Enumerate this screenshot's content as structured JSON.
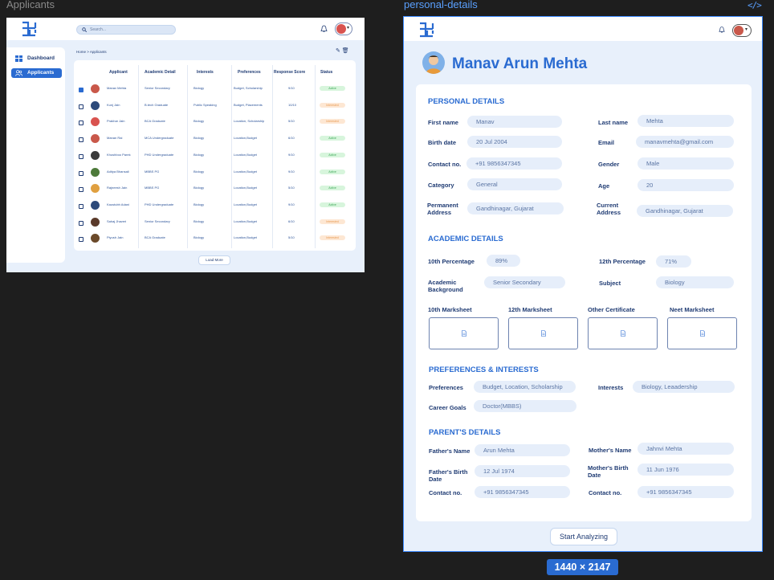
{
  "canvas": {
    "left_frame_label": "Applicants",
    "right_frame_label": "personal-details",
    "code_icon": "</>",
    "size_badge": "1440 × 2147"
  },
  "applicants": {
    "search_placeholder": "Search...",
    "sidebar": [
      {
        "label": "Dashboard",
        "icon": "grid-icon"
      },
      {
        "label": "Applicants",
        "icon": "users-icon",
        "active": true
      }
    ],
    "breadcrumb": "Home > Applicants",
    "tools": "✎ 🗑",
    "columns": [
      "Applicant",
      "Academic Detail",
      "Interests",
      "Preferences",
      "Response Score",
      "Status"
    ],
    "rows": [
      {
        "name": "Manav Mehta",
        "academic": "Senior Secondary",
        "interests": "Biology",
        "prefs": "Budget, Scholarship",
        "score": "9/10",
        "status": "Active",
        "checked": true,
        "av": "#c9584a"
      },
      {
        "name": "Kunj Jain",
        "academic": "B.tech Graduate",
        "interests": "Public Speaking",
        "prefs": "Budget, Placements",
        "score": "10/10",
        "status": "Interested",
        "checked": false,
        "av": "#2d4a7a"
      },
      {
        "name": "Prakhar Jain",
        "academic": "BCA Graduate",
        "interests": "Biology",
        "prefs": "Location, Scholarship",
        "score": "5/10",
        "status": "Interested",
        "checked": false,
        "av": "#d9534f"
      },
      {
        "name": "Manan Rai",
        "academic": "MCA Undergraduate",
        "interests": "Biology",
        "prefs": "Location,Budget",
        "score": "6/10",
        "status": "Active",
        "checked": false,
        "av": "#c9584a"
      },
      {
        "name": "Khushboo Parek",
        "academic": "PHD Undergraduate",
        "interests": "Biology",
        "prefs": "Location,Budget",
        "score": "9/10",
        "status": "Active",
        "checked": false,
        "av": "#3a3a3a"
      },
      {
        "name": "Aditya Bhansali",
        "academic": "MBBS PG",
        "interests": "Biology",
        "prefs": "Location,Budget",
        "score": "9/10",
        "status": "Active",
        "checked": false,
        "av": "#4d7a3a"
      },
      {
        "name": "Rajneesh Jain",
        "academic": "MBBS PG",
        "interests": "Biology",
        "prefs": "Location,Budget",
        "score": "5/10",
        "status": "Active",
        "checked": false,
        "av": "#e0a040"
      },
      {
        "name": "Kaustubh Adani",
        "academic": "PHD Undergraduate",
        "interests": "Biology",
        "prefs": "Location,Budget",
        "score": "9/10",
        "status": "Active",
        "checked": false,
        "av": "#2d4a7a"
      },
      {
        "name": "Sahaj Jhaveri",
        "academic": "Senior Secondary",
        "interests": "Biology",
        "prefs": "Location,Budget",
        "score": "6/10",
        "status": "Interested",
        "checked": false,
        "av": "#5a3a2a"
      },
      {
        "name": "Piyush Jain",
        "academic": "BCA Graduate",
        "interests": "Biology",
        "prefs": "Location,Budget",
        "score": "5/10",
        "status": "Interested",
        "checked": false,
        "av": "#6b4a2a"
      }
    ],
    "load_more": "Load More"
  },
  "details": {
    "name": "Manav Arun Mehta",
    "sections": {
      "personal": "PERSONAL DETAILS",
      "academic": "ACADEMIC DETAILS",
      "prefs": "PREFERENCES & INTERESTS",
      "parents": "PARENT'S  DETAILS"
    },
    "personal": {
      "first_name_label": "First name",
      "first_name": "Manav",
      "last_name_label": "Last name",
      "last_name": "Mehta",
      "birth_label": "Birth date",
      "birth": "20 Jul 2004",
      "email_label": "Email",
      "email": "manavmehta@gmail.com",
      "contact_label": "Contact no.",
      "contact": "+91 9856347345",
      "gender_label": "Gender",
      "gender": "Male",
      "category_label": "Category",
      "category": "General",
      "age_label": "Age",
      "age": "20",
      "perm_label_1": "Permanent",
      "perm_label_2": "Address",
      "perm": "Gandhinagar, Gujarat",
      "curr_label_1": "Current",
      "curr_label_2": "Address",
      "curr": "Gandhinagar, Gujarat"
    },
    "academic": {
      "tenth_label": "10th Percentage",
      "tenth": "89%",
      "twelfth_label": "12th Percentage",
      "twelfth": "71%",
      "bg_label_1": "Academic",
      "bg_label_2": "Background",
      "bg": "Senior Secondary",
      "subject_label": "Subject",
      "subject": "Biology",
      "uploads": [
        "10th  Marksheet",
        "12th Marksheet",
        "Other Certificate",
        "Neet  Marksheet"
      ]
    },
    "prefs": {
      "pref_label": "Preferences",
      "pref": "Budget, Location, Scholarship",
      "interests_label": "Interests",
      "interests": "Biology, Leaadership",
      "goals_label": "Career Goals",
      "goals": "Doctor(MBBS)"
    },
    "parents": {
      "father_label": "Father's Name",
      "father": "Arun Mehta",
      "mother_label": "Mother's Name",
      "mother": "Jahnvi Mehta",
      "fbirth_label_1": "Father's Birth",
      "fbirth_label_2": "Date",
      "fbirth": "12 Jul 1974",
      "mbirth_label_1": "Mother's Birth",
      "mbirth_label_2": "Date",
      "mbirth": "11 Jun 1976",
      "fcontact_label": "Contact no.",
      "fcontact": "+91 9856347345",
      "mcontact_label": "Contact no.",
      "mcontact": "+91 9856347345"
    },
    "start_button": "Start Analyzing"
  }
}
